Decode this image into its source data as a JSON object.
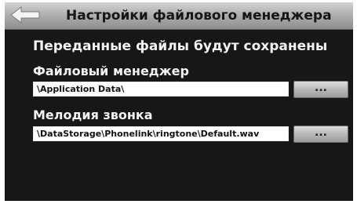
{
  "header": {
    "title": "Настройки файлового менеджера",
    "back_icon": "back-arrow-icon"
  },
  "info": {
    "message": "Переданные файлы будут сохранены"
  },
  "file_manager": {
    "label": "Файловый менеджер",
    "path": "\\Application Data\\",
    "browse_label": "..."
  },
  "ringtone": {
    "label": "Мелодия звонка",
    "path": "\\DataStorage\\Phonelink\\ringtone\\Default.wav",
    "browse_label": "..."
  }
}
